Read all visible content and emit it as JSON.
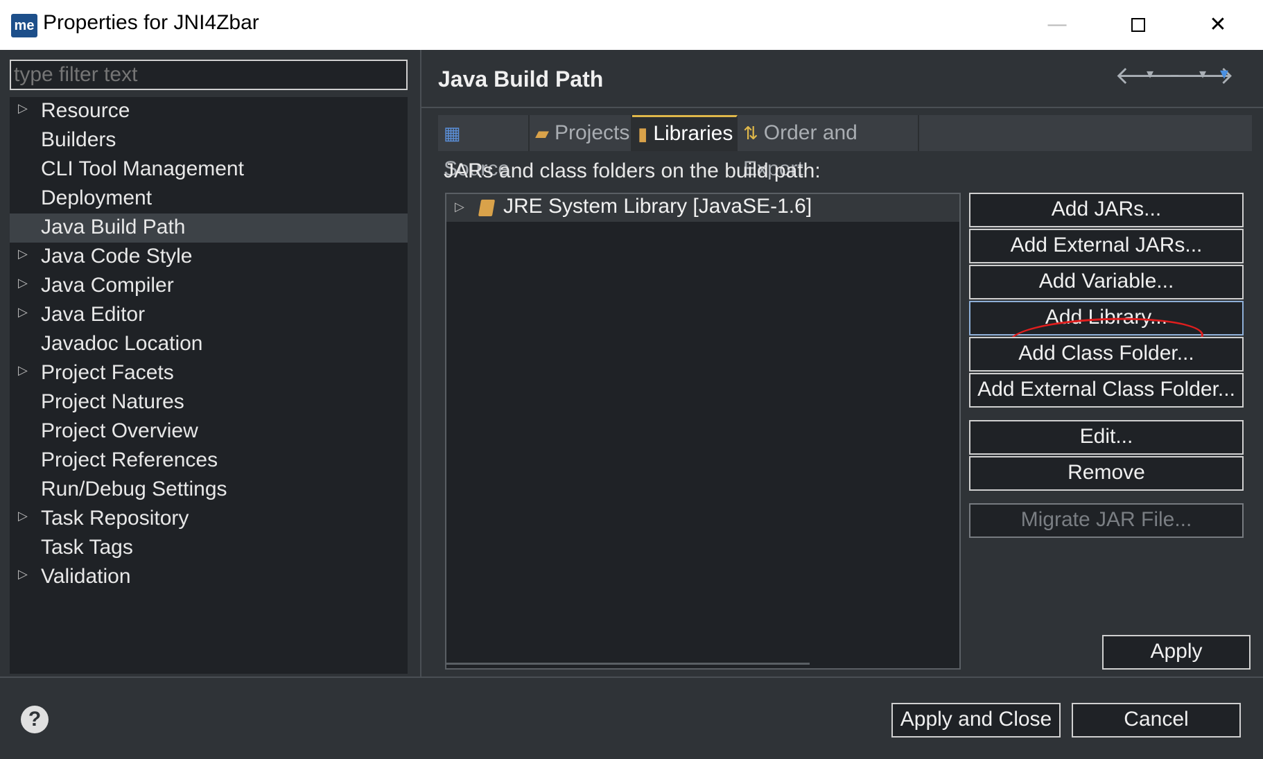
{
  "window": {
    "app_icon_text": "me",
    "title": "Properties for JNI4Zbar",
    "minimize": "—",
    "close": "✕"
  },
  "filter": {
    "placeholder": "type filter text",
    "value": ""
  },
  "tree": [
    {
      "label": "Resource",
      "expandable": true,
      "selected": false
    },
    {
      "label": "Builders",
      "expandable": false,
      "selected": false
    },
    {
      "label": "CLI Tool Management",
      "expandable": false,
      "selected": false
    },
    {
      "label": "Deployment",
      "expandable": false,
      "selected": false
    },
    {
      "label": "Java Build Path",
      "expandable": false,
      "selected": true
    },
    {
      "label": "Java Code Style",
      "expandable": true,
      "selected": false
    },
    {
      "label": "Java Compiler",
      "expandable": true,
      "selected": false
    },
    {
      "label": "Java Editor",
      "expandable": true,
      "selected": false
    },
    {
      "label": "Javadoc Location",
      "expandable": false,
      "selected": false
    },
    {
      "label": "Project Facets",
      "expandable": true,
      "selected": false
    },
    {
      "label": "Project Natures",
      "expandable": false,
      "selected": false
    },
    {
      "label": "Project Overview",
      "expandable": false,
      "selected": false
    },
    {
      "label": "Project References",
      "expandable": false,
      "selected": false
    },
    {
      "label": "Run/Debug Settings",
      "expandable": false,
      "selected": false
    },
    {
      "label": "Task Repository",
      "expandable": true,
      "selected": false
    },
    {
      "label": "Task Tags",
      "expandable": false,
      "selected": false
    },
    {
      "label": "Validation",
      "expandable": true,
      "selected": false
    }
  ],
  "page": {
    "title": "Java Build Path",
    "nav_icons": [
      "back-arrow-icon",
      "dropdown-icon",
      "forward-arrow-icon",
      "dropdown-icon",
      "menu-dropdown-icon"
    ]
  },
  "tabs": [
    {
      "label": "Source",
      "icon": "source-folder-icon",
      "active": false
    },
    {
      "label": "Projects",
      "icon": "folder-icon",
      "active": false
    },
    {
      "label": "Libraries",
      "icon": "library-book-icon",
      "active": true
    },
    {
      "label": "Order and Export",
      "icon": "order-arrows-icon",
      "active": false
    }
  ],
  "libraries": {
    "label": "JARs and class folders on the build path:",
    "items": [
      {
        "label": "JRE System Library [JavaSE-1.6]",
        "icon": "library-book-icon"
      }
    ]
  },
  "buttons": {
    "add_jars": "Add JARs...",
    "add_external_jars": "Add External JARs...",
    "add_variable": "Add Variable...",
    "add_library": "Add Library...",
    "add_class_folder": "Add Class Folder...",
    "add_external_class_folder": "Add External Class Folder...",
    "edit": "Edit...",
    "remove": "Remove",
    "migrate_jar": "Migrate JAR File...",
    "apply": "Apply"
  },
  "footer": {
    "help": "?",
    "apply_and_close": "Apply and Close",
    "cancel": "Cancel"
  },
  "colors": {
    "background": "#2f3337",
    "panel": "#1f2226",
    "annotation": "#e01e1e",
    "active_tab_accent": "#e0b84a"
  }
}
